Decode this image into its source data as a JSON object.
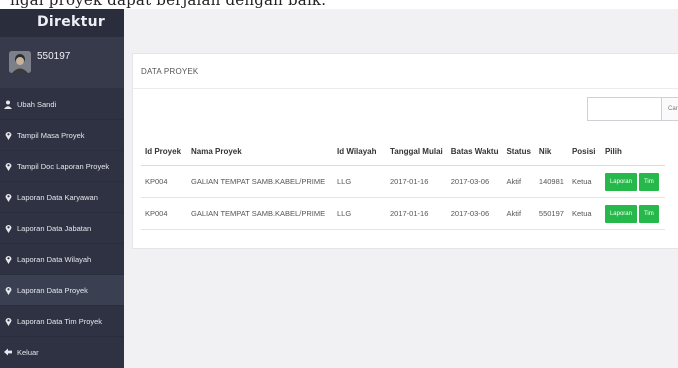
{
  "header_caption": "ngai proyek dapat berjalan dengan baik.",
  "sidebar": {
    "brand": "Direktur",
    "username": "550197",
    "items": [
      {
        "label": "Ubah Sandi",
        "icon": "user-icon"
      },
      {
        "label": "Tampil Masa Proyek",
        "icon": "pin-icon"
      },
      {
        "label": "Tampil Doc Laporan Proyek",
        "icon": "pin-icon"
      },
      {
        "label": "Laporan Data Karyawan",
        "icon": "pin-icon"
      },
      {
        "label": "Laporan Data Jabatan",
        "icon": "pin-icon"
      },
      {
        "label": "Laporan Data Wilayah",
        "icon": "pin-icon"
      },
      {
        "label": "Laporan Data Proyek",
        "icon": "pin-icon",
        "active": true
      },
      {
        "label": "Laporan Data Tim Proyek",
        "icon": "pin-icon"
      },
      {
        "label": "Keluar",
        "icon": "back-arrow-icon"
      }
    ]
  },
  "panel": {
    "title": "DATA PROYEK",
    "search": {
      "value": "",
      "button_label": "Cari"
    }
  },
  "table": {
    "columns": [
      "Id Proyek",
      "Nama Proyek",
      "Id Wilayah",
      "Tanggal Mulai",
      "Batas Waktu",
      "Status",
      "Nik",
      "Posisi",
      "Pilih"
    ],
    "rows": [
      [
        "KP004",
        "GALIAN TEMPAT SAMB.KABEL/PRIME",
        "LLG",
        "2017-01-16",
        "2017-03-06",
        "Aktif",
        "140981",
        "Ketua"
      ],
      [
        "KP004",
        "GALIAN TEMPAT SAMB.KABEL/PRIME",
        "LLG",
        "2017-01-16",
        "2017-03-06",
        "Aktif",
        "550197",
        "Ketua"
      ]
    ],
    "actions": {
      "report_label": "Laporan",
      "team_label": "Tim"
    }
  },
  "colors": {
    "sidebar": "#2f3242",
    "accent_green": "#26b84a",
    "content_bg": "#f1f1f4"
  }
}
